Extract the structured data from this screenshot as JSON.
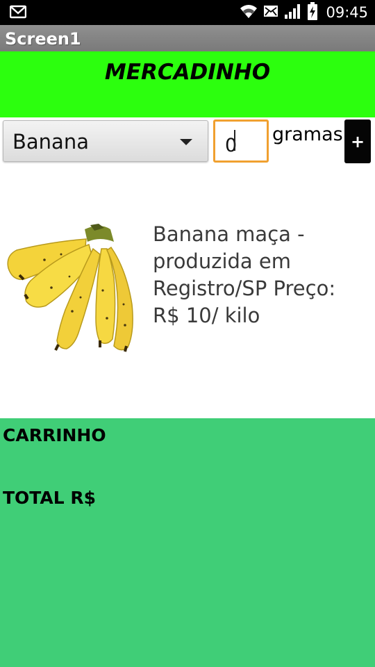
{
  "status_bar": {
    "time": "09:45",
    "icons": [
      "gmail-icon",
      "wifi-icon",
      "message-icon",
      "signal-icon",
      "battery-charging-icon"
    ]
  },
  "app": {
    "title": "Screen1"
  },
  "header": {
    "title": "MERCADINHO",
    "color": "#2cff0e"
  },
  "controls": {
    "product_selected": "Banana",
    "quantity_value": "0",
    "unit_label": "gramas",
    "add_label": "+"
  },
  "product": {
    "image": "banana-bunch-image",
    "description": "Banana maça - produzida em Registro/SP  Preço: R$ 10/ kilo"
  },
  "cart": {
    "title": "CARRINHO",
    "total_label": "TOTAL R$",
    "color": "#40ce77"
  },
  "colors": {
    "input_focus": "#f0a030",
    "add_button": "#050505"
  }
}
